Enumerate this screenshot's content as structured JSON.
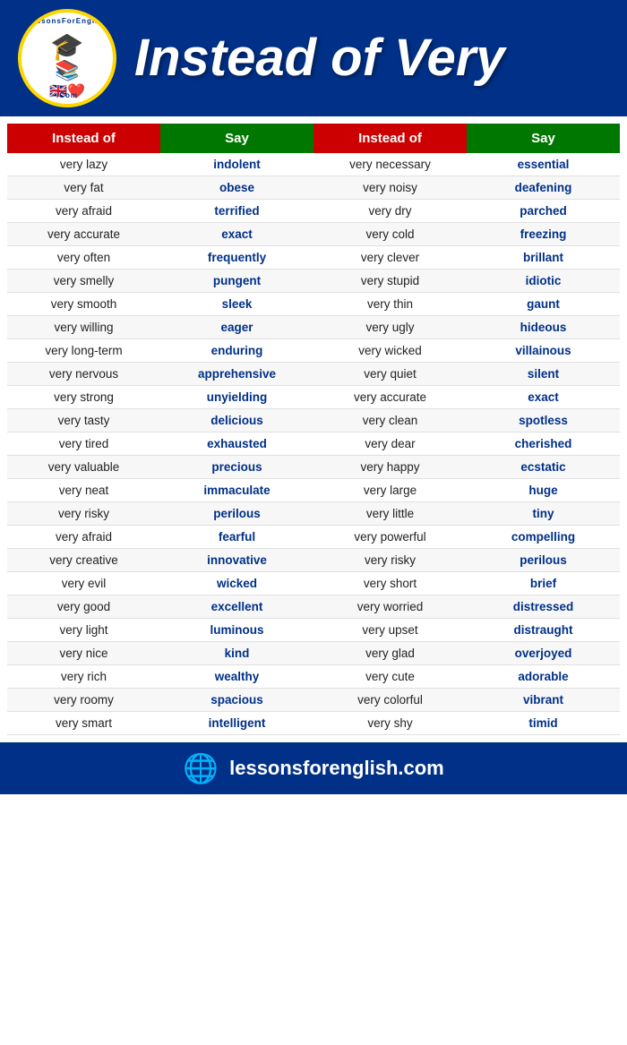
{
  "header": {
    "title": "Instead of Very",
    "logo_top_text": "LessonsForEnglish",
    "logo_com": ".Com",
    "logo_hat": "🎓",
    "logo_books": "📚",
    "logo_heart": "❤️",
    "logo_flag": "🇬🇧"
  },
  "table": {
    "col1_header": "Instead of",
    "col2_header": "Say",
    "col3_header": "Instead of",
    "col4_header": "Say",
    "rows": [
      [
        "very lazy",
        "indolent",
        "very necessary",
        "essential"
      ],
      [
        "very fat",
        "obese",
        "very noisy",
        "deafening"
      ],
      [
        "very afraid",
        "terrified",
        "very dry",
        "parched"
      ],
      [
        "very accurate",
        "exact",
        "very cold",
        "freezing"
      ],
      [
        "very often",
        "frequently",
        "very clever",
        "brillant"
      ],
      [
        "very smelly",
        "pungent",
        "very stupid",
        "idiotic"
      ],
      [
        "very smooth",
        "sleek",
        "very thin",
        "gaunt"
      ],
      [
        "very willing",
        "eager",
        "very ugly",
        "hideous"
      ],
      [
        "very long-term",
        "enduring",
        "very wicked",
        "villainous"
      ],
      [
        "very nervous",
        "apprehensive",
        "very quiet",
        "silent"
      ],
      [
        "very strong",
        "unyielding",
        "very accurate",
        "exact"
      ],
      [
        "very tasty",
        "delicious",
        "very clean",
        "spotless"
      ],
      [
        "very tired",
        "exhausted",
        "very dear",
        "cherished"
      ],
      [
        "very valuable",
        "precious",
        "very happy",
        "ecstatic"
      ],
      [
        "very neat",
        "immaculate",
        "very large",
        "huge"
      ],
      [
        "very risky",
        "perilous",
        "very little",
        "tiny"
      ],
      [
        "very afraid",
        "fearful",
        "very powerful",
        "compelling"
      ],
      [
        "very creative",
        "innovative",
        "very risky",
        "perilous"
      ],
      [
        "very evil",
        "wicked",
        "very short",
        "brief"
      ],
      [
        "very good",
        "excellent",
        "very worried",
        "distressed"
      ],
      [
        "very light",
        "luminous",
        "very upset",
        "distraught"
      ],
      [
        "very nice",
        "kind",
        "very glad",
        "overjoyed"
      ],
      [
        "very rich",
        "wealthy",
        "very cute",
        "adorable"
      ],
      [
        "very roomy",
        "spacious",
        "very colorful",
        "vibrant"
      ],
      [
        "very smart",
        "intelligent",
        "very shy",
        "timid"
      ]
    ]
  },
  "footer": {
    "globe": "🌐",
    "text": "lessonsforenglish.com"
  }
}
